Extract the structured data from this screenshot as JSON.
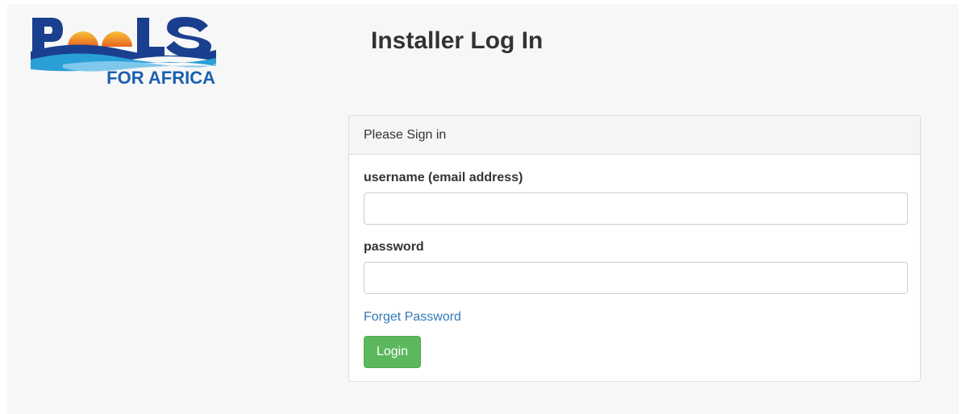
{
  "logo": {
    "brand_word": "POOLS",
    "tagline": "FOR AFRICA",
    "colors": {
      "navy": "#1b3f8f",
      "sun": "#f0a020",
      "wave": "#2a9fd6"
    }
  },
  "header": {
    "title": "Installer Log In"
  },
  "panel": {
    "heading": "Please Sign in",
    "username_label": "username (email address)",
    "username_value": "",
    "password_label": "password",
    "password_value": "",
    "forgot_link": "Forget Password",
    "login_button": "Login"
  },
  "colors": {
    "page_background": "#f7f7f7",
    "link": "#337ab7",
    "login_button": "#5cb85c"
  }
}
